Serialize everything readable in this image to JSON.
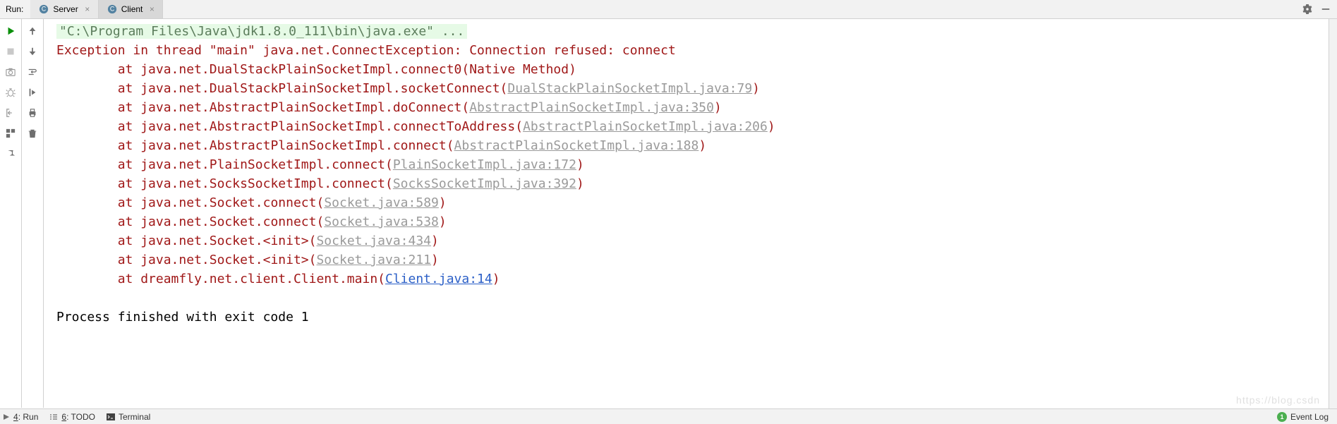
{
  "run_label": "Run:",
  "tabs": [
    {
      "label": "Server",
      "icon": "java-class-icon"
    },
    {
      "label": "Client",
      "icon": "java-class-icon"
    }
  ],
  "active_tab_index": 1,
  "console": {
    "command_line": "\"C:\\Program Files\\Java\\jdk1.8.0_111\\bin\\java.exe\" ...",
    "exception_line": "Exception in thread \"main\" java.net.ConnectException: Connection refused: connect",
    "trace": [
      {
        "prefix": "\tat java.net.DualStackPlainSocketImpl.connect0(Native Method)",
        "link": null,
        "suffix": ""
      },
      {
        "prefix": "\tat java.net.DualStackPlainSocketImpl.socketConnect(",
        "link": "DualStackPlainSocketImpl.java:79",
        "suffix": ")"
      },
      {
        "prefix": "\tat java.net.AbstractPlainSocketImpl.doConnect(",
        "link": "AbstractPlainSocketImpl.java:350",
        "suffix": ")"
      },
      {
        "prefix": "\tat java.net.AbstractPlainSocketImpl.connectToAddress(",
        "link": "AbstractPlainSocketImpl.java:206",
        "suffix": ")"
      },
      {
        "prefix": "\tat java.net.AbstractPlainSocketImpl.connect(",
        "link": "AbstractPlainSocketImpl.java:188",
        "suffix": ")"
      },
      {
        "prefix": "\tat java.net.PlainSocketImpl.connect(",
        "link": "PlainSocketImpl.java:172",
        "suffix": ")"
      },
      {
        "prefix": "\tat java.net.SocksSocketImpl.connect(",
        "link": "SocksSocketImpl.java:392",
        "suffix": ")"
      },
      {
        "prefix": "\tat java.net.Socket.connect(",
        "link": "Socket.java:589",
        "suffix": ")"
      },
      {
        "prefix": "\tat java.net.Socket.connect(",
        "link": "Socket.java:538",
        "suffix": ")"
      },
      {
        "prefix": "\tat java.net.Socket.<init>(",
        "link": "Socket.java:434",
        "suffix": ")"
      },
      {
        "prefix": "\tat java.net.Socket.<init>(",
        "link": "Socket.java:211",
        "suffix": ")"
      },
      {
        "prefix": "\tat dreamfly.net.client.Client.main(",
        "link": "Client.java:14",
        "link_blue": true,
        "suffix": ")"
      }
    ],
    "exit_line": "Process finished with exit code 1"
  },
  "bottom": {
    "run": "4: Run",
    "todo": "6: TODO",
    "terminal": "Terminal",
    "event_log": "Event Log",
    "event_badge": "1"
  },
  "watermark": "https://blog.csdn"
}
